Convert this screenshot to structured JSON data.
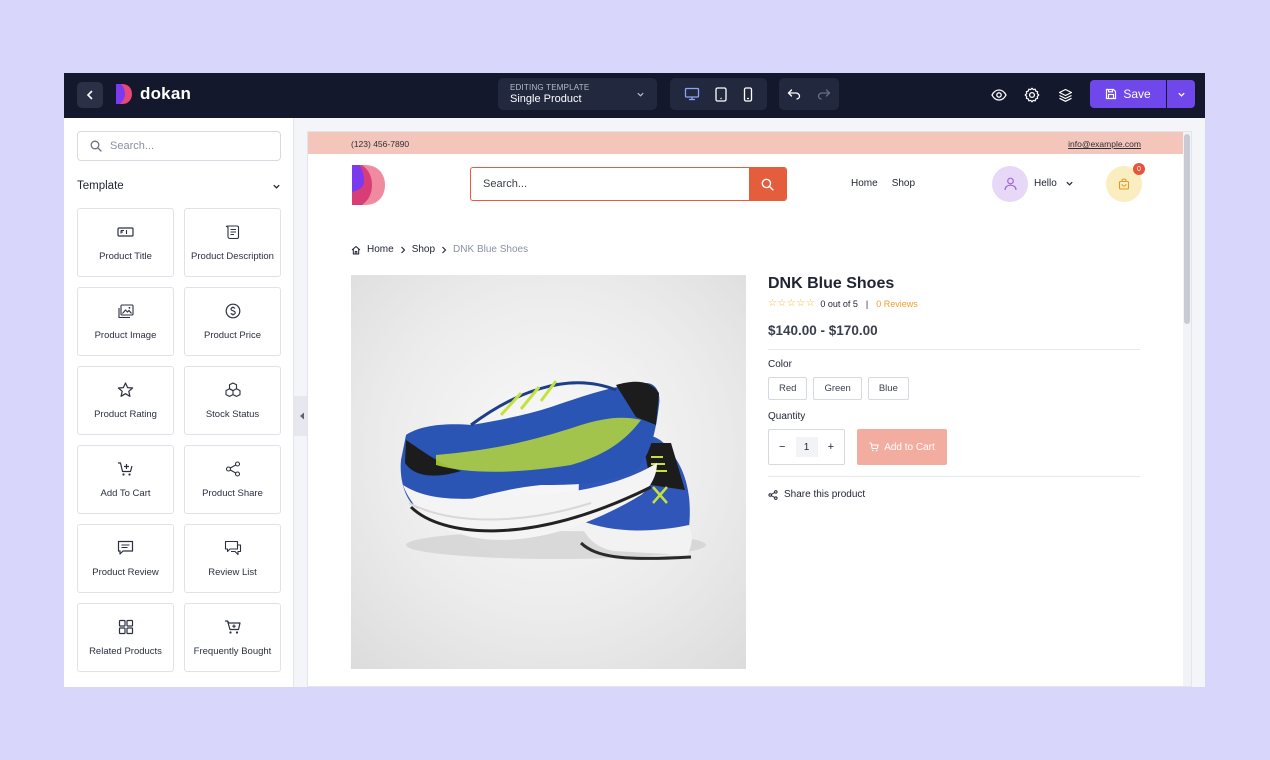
{
  "topbar": {
    "logo_text": "dokan",
    "template_caption": "EDITING TEMPLATE",
    "template_value": "Single Product",
    "save_label": "Save"
  },
  "sidebar": {
    "search_placeholder": "Search...",
    "section_title": "Template",
    "tiles": [
      {
        "label": "Product Title",
        "icon": "product-title-icon"
      },
      {
        "label": "Product Description",
        "icon": "product-description-icon"
      },
      {
        "label": "Product Image",
        "icon": "product-image-icon"
      },
      {
        "label": "Product Price",
        "icon": "product-price-icon"
      },
      {
        "label": "Product Rating",
        "icon": "product-rating-icon"
      },
      {
        "label": "Stock Status",
        "icon": "stock-status-icon"
      },
      {
        "label": "Add To Cart",
        "icon": "add-to-cart-icon"
      },
      {
        "label": "Product Share",
        "icon": "product-share-icon"
      },
      {
        "label": "Product Review",
        "icon": "product-review-icon"
      },
      {
        "label": "Review List",
        "icon": "review-list-icon"
      },
      {
        "label": "Related Products",
        "icon": "related-products-icon"
      },
      {
        "label": "Frequently Bought",
        "icon": "frequently-bought-icon"
      }
    ]
  },
  "preview": {
    "phone": "(123) 456-7890",
    "email": "info@example.com",
    "search_placeholder": "Search...",
    "nav": [
      "Home",
      "Shop"
    ],
    "user_label": "Hello",
    "cart_count": "0",
    "breadcrumb": [
      "Home",
      "Shop",
      "DNK Blue Shoes"
    ],
    "product": {
      "title": "DNK Blue Shoes",
      "rating_text": "0 out of 5",
      "rating_sep": "|",
      "reviews": "0 Reviews",
      "price": "$140.00 - $170.00",
      "color_label": "Color",
      "colors": [
        "Red",
        "Green",
        "Blue"
      ],
      "quantity_label": "Quantity",
      "quantity": "1",
      "add_to_cart": "Add to Cart",
      "share_label": "Share this product"
    }
  },
  "colors": {
    "accent": "#7047eb",
    "brand_orange": "#e45d3c",
    "topbar": "#13182c"
  }
}
